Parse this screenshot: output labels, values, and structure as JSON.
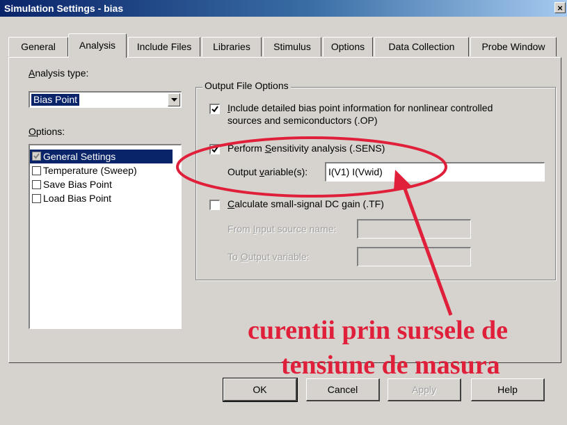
{
  "window": {
    "title": "Simulation Settings - bias",
    "close_glyph": "×"
  },
  "tabs": [
    {
      "label": "General"
    },
    {
      "label": "Analysis"
    },
    {
      "label": "Include Files"
    },
    {
      "label": "Libraries"
    },
    {
      "label": "Stimulus"
    },
    {
      "label": "Options"
    },
    {
      "label": "Data Collection"
    },
    {
      "label": "Probe Window"
    }
  ],
  "active_tab": "Analysis",
  "analysis_type": {
    "label_first": "A",
    "label_rest": "nalysis type:",
    "selected": "Bias Point"
  },
  "options": {
    "label_first": "O",
    "label_rest": "ptions:",
    "items": [
      {
        "label": "General Settings",
        "checked": true,
        "selected": true
      },
      {
        "label": "Temperature (Sweep)",
        "checked": false
      },
      {
        "label": "Save Bias Point",
        "checked": false
      },
      {
        "label": "Load Bias Point",
        "checked": false
      }
    ]
  },
  "output_file_options": {
    "group_title": "Output File Options",
    "include_detailed": {
      "line1_first": "I",
      "line1_rest": "nclude detailed bias point information for nonlinear controlled",
      "line2": "sources and semiconductors (.OP)",
      "checked": true
    },
    "sensitivity": {
      "label_pre": "Perform ",
      "label_u": "S",
      "label_post": "ensitivity analysis (.SENS)",
      "checked": true
    },
    "output_variable": {
      "label_pre": "Output ",
      "label_u": "v",
      "label_post": "ariable(s):",
      "value": "I(V1) I(Vwid)"
    },
    "dc_gain": {
      "label_first": "C",
      "label_rest": "alculate small-signal DC gain (.TF)",
      "checked": false
    },
    "from_input": {
      "label_pre": "From ",
      "label_u": "I",
      "label_post": "nput source name:",
      "value": ""
    },
    "to_output": {
      "label_pre": "To ",
      "label_u": "O",
      "label_post": "utput variable:",
      "value": ""
    }
  },
  "annotation": {
    "line1": "curentii prin sursele de",
    "line2": "tensiune de masura",
    "color": "#e0203a"
  },
  "buttons": {
    "ok": "OK",
    "cancel": "Cancel",
    "apply": "Apply",
    "help": "Help"
  }
}
